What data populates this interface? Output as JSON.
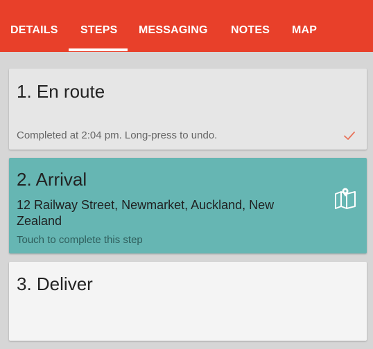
{
  "tabs": [
    {
      "label": "DETAILS"
    },
    {
      "label": "STEPS",
      "selected": true
    },
    {
      "label": "MESSAGING"
    },
    {
      "label": "NOTES"
    },
    {
      "label": "MAP"
    }
  ],
  "steps": [
    {
      "title": "1. En route",
      "status": "Completed at 2:04 pm. Long-press to undo.",
      "completed": true,
      "icon": "check-icon"
    },
    {
      "title": "2. Arrival",
      "address": "12 Railway Street, Newmarket, Auckland, New Zealand",
      "hint": "Touch to complete this step",
      "active": true,
      "icon": "map-icon"
    },
    {
      "title": "3. Deliver"
    }
  ],
  "colors": {
    "accent": "#e8402a",
    "active_card": "#66b6b3",
    "completed_card": "#e6e6e6",
    "pending_card": "#f4f4f4",
    "background": "#d6d6d6"
  }
}
